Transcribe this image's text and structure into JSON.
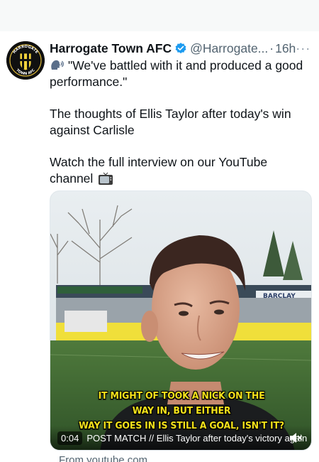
{
  "tweet": {
    "author_name": "Harrogate Town AFC",
    "handle": "@Harrogate...",
    "separator": "·",
    "time": "16h",
    "more": "···",
    "quote_line": "\"We've battled with it and produced a good performance.\"",
    "line2": "The thoughts of Ellis Taylor after today's win against Carlisle",
    "line3": "Watch the full interview on our YouTube channel",
    "avatar_text_top": "HARROGATE",
    "avatar_text_bottom": "TOWN AFC"
  },
  "video": {
    "caption_line1": "IT MIGHT OF TOOK A NICK ON THE",
    "caption_line2": "WAY IN, BUT EITHER",
    "caption_line3": "WAY IT GOES IN IS STILL A GOAL, ISN'T IT?",
    "duration": "0:04",
    "title": "POST MATCH // Ellis Taylor after today's victory again",
    "stand_sign": "BARCLAY"
  },
  "source": "From youtube.com",
  "colors": {
    "verified": "#1d9bf0",
    "caption": "#f4e21a",
    "muted_text": "#536471"
  }
}
